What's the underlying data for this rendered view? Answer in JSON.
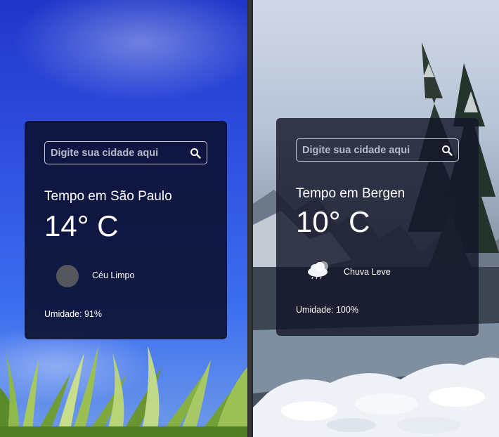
{
  "panels": [
    {
      "search": {
        "placeholder": "Digite sua cidade aqui"
      },
      "city_title": "Tempo em São Paulo",
      "temperature": "14° C",
      "condition": {
        "icon": "clear-sky-icon",
        "label": "Céu Limpo"
      },
      "humidity": "Umidade: 91%",
      "background": "blue-sky-grass"
    },
    {
      "search": {
        "placeholder": "Digite sua cidade aqui"
      },
      "city_title": "Tempo em Bergen",
      "temperature": "10° C",
      "condition": {
        "icon": "light-rain-cloud-icon",
        "label": "Chuva Leve"
      },
      "humidity": "Umidade: 100%",
      "background": "snowy-forest-river"
    }
  ],
  "colors": {
    "card_background": "#0a0e2a",
    "text": "#ffffff",
    "search_border": "#c7cbd6",
    "sky_blue": "#2f4fe0"
  }
}
